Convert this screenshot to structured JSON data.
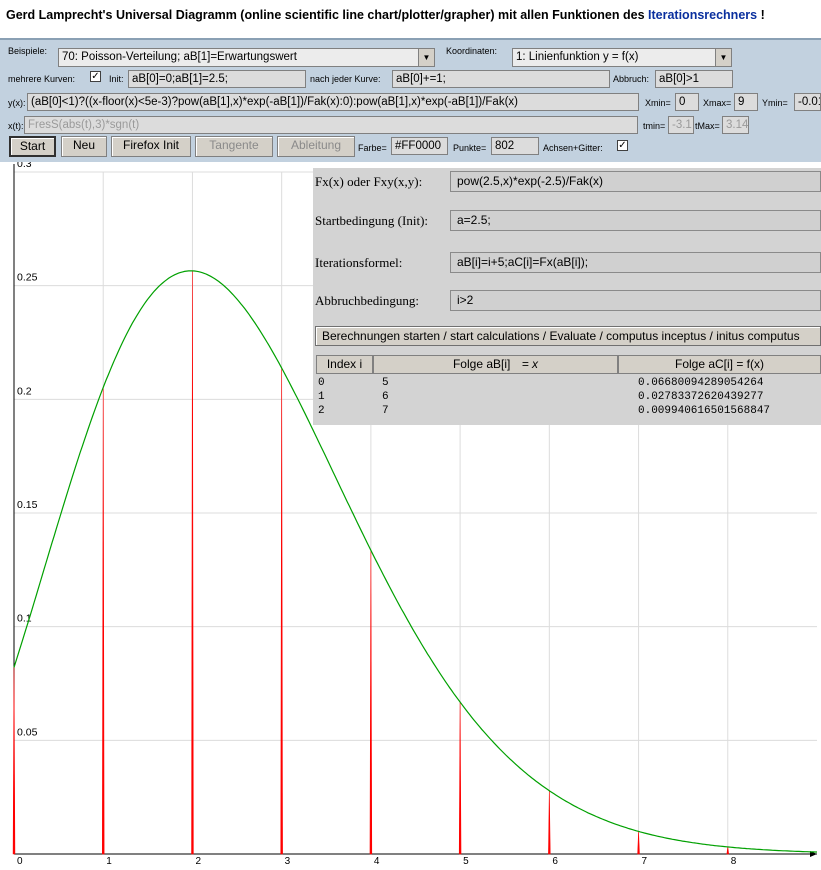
{
  "header": {
    "title_prefix": "Gerd Lamprecht's Universal Diagramm (online scientific line chart/plotter/grapher) mit allen Funktionen des ",
    "title_link": "Iterationsrechners",
    "title_suffix": " !"
  },
  "controls": {
    "beispiele_label": "Beispiele:",
    "beispiele_value": "70: Poisson-Verteilung; aB[1]=Erwartungswert",
    "koordinaten_label": "Koordinaten:",
    "koordinaten_value": "1: Linienfunktion y = f(x)",
    "mehrere_label": "mehrere Kurven:",
    "mehrere_checked": "✓",
    "init_label": "Init:",
    "init_value": "aB[0]=0;aB[1]=2.5;",
    "nach_label": "nach jeder Kurve:",
    "nach_value": "aB[0]+=1;",
    "abbruch_label": "Abbruch:",
    "abbruch_value": "aB[0]>1",
    "yx_label": "y(x):",
    "yx_value": "(aB[0]<1)?((x-floor(x)<5e-3)?pow(aB[1],x)*exp(-aB[1])/Fak(x):0):pow(aB[1],x)*exp(-aB[1])/Fak(x)",
    "xmin_label": "Xmin=",
    "xmin_value": "0",
    "xmax_label": "Xmax=",
    "xmax_value": "9",
    "ymin_label": "Ymin=",
    "ymin_value": "-0.01",
    "xt_label": "x(t):",
    "xt_value": "FresS(abs(t),3)*sgn(t)",
    "tmin_label": "tmin=",
    "tmin_value": "-3.1",
    "tmax_label": "tMax=",
    "tmax_value": "3.14",
    "buttons": [
      "Start",
      "Neu",
      "Firefox Init",
      "Tangente",
      "Ableitung"
    ],
    "farbe_label": "Farbe=",
    "farbe_value": "#FF0000",
    "punkte_label": "Punkte=",
    "punkte_value": "802",
    "achsen_label": "Achsen+Gitter:",
    "achsen_checked": "✓"
  },
  "iteration": {
    "fx_label": "Fx(x) oder Fxy(x,y):",
    "fx_value": "pow(2.5,x)*exp(-2.5)/Fak(x)",
    "start_label": "Startbedingung (Init):",
    "start_value": "a=2.5;",
    "formel_label": "Iterationsformel:",
    "formel_value": "aB[i]=i+5;aC[i]=Fx(aB[i]);",
    "abbruch_label": "Abbruchbedingung:",
    "abbruch_value": "i>2",
    "calc_button": "Berechnungen starten / start calculations / Evaluate / computus inceptus / initus computus",
    "table_headers": [
      "Index i",
      "Folge aB[i]",
      "= x",
      "Folge aC[i] = f(x)"
    ],
    "rows": [
      [
        "0",
        "5",
        "0.06680094289054264"
      ],
      [
        "1",
        "6",
        "0.02783372620439277"
      ],
      [
        "2",
        "7",
        "0.009940616501568847"
      ]
    ]
  },
  "chart_data": {
    "type": "line",
    "title": "",
    "xlabel": "",
    "ylabel": "",
    "xlim": [
      0,
      9
    ],
    "ylim": [
      0,
      0.3
    ],
    "x_ticks": [
      "0",
      "1",
      "2",
      "3",
      "4",
      "5",
      "6",
      "7",
      "8"
    ],
    "y_ticks": [
      "0.05",
      "0.1",
      "0.15",
      "0.2",
      "0.25",
      "0.3"
    ],
    "grid": true,
    "series": [
      {
        "kind": "spikes",
        "color": "#FF0000",
        "x": [
          0,
          1,
          2,
          3,
          4,
          5,
          6,
          7,
          8
        ],
        "y": [
          0.0821,
          0.2052,
          0.2565,
          0.2138,
          0.1336,
          0.0668,
          0.0278,
          0.0099,
          0.0031
        ]
      },
      {
        "kind": "curve",
        "color": "#00A000",
        "function": "pow(2.5,x)*exp(-2.5)/Fak(x)",
        "x_range": [
          0,
          9
        ]
      }
    ]
  }
}
